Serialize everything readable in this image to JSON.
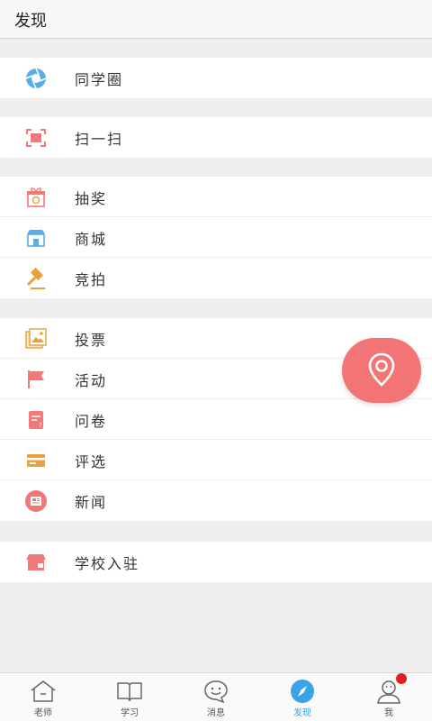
{
  "header": {
    "title": "发现"
  },
  "groups": [
    {
      "items": [
        {
          "label": "同学圈",
          "icon": "camera-aperture-icon"
        }
      ]
    },
    {
      "items": [
        {
          "label": "扫一扫",
          "icon": "scan-icon"
        }
      ]
    },
    {
      "items": [
        {
          "label": "抽奖",
          "icon": "gift-icon"
        },
        {
          "label": "商城",
          "icon": "shop-icon"
        },
        {
          "label": "竞拍",
          "icon": "gavel-icon"
        }
      ]
    },
    {
      "items": [
        {
          "label": "投票",
          "icon": "picture-vote-icon"
        },
        {
          "label": "活动",
          "icon": "flag-icon"
        },
        {
          "label": "问卷",
          "icon": "questionnaire-icon"
        },
        {
          "label": "评选",
          "icon": "card-icon"
        },
        {
          "label": "新闻",
          "icon": "news-icon"
        }
      ]
    },
    {
      "items": [
        {
          "label": "学校入驻",
          "icon": "school-store-icon"
        }
      ]
    }
  ],
  "fab": {
    "icon": "location-pin-icon",
    "color": "#f27474"
  },
  "tabbar": {
    "tabs": [
      {
        "label": "老师",
        "icon": "home-icon"
      },
      {
        "label": "学习",
        "icon": "book-icon"
      },
      {
        "label": "消息",
        "icon": "chat-face-icon"
      },
      {
        "label": "发现",
        "icon": "compass-icon",
        "active": true
      },
      {
        "label": "我",
        "icon": "person-icon"
      }
    ],
    "active_color": "#3aa3e8"
  },
  "colors": {
    "accent_pink": "#f07a7a",
    "accent_orange": "#e8a040",
    "accent_blue": "#3aa3e8"
  }
}
